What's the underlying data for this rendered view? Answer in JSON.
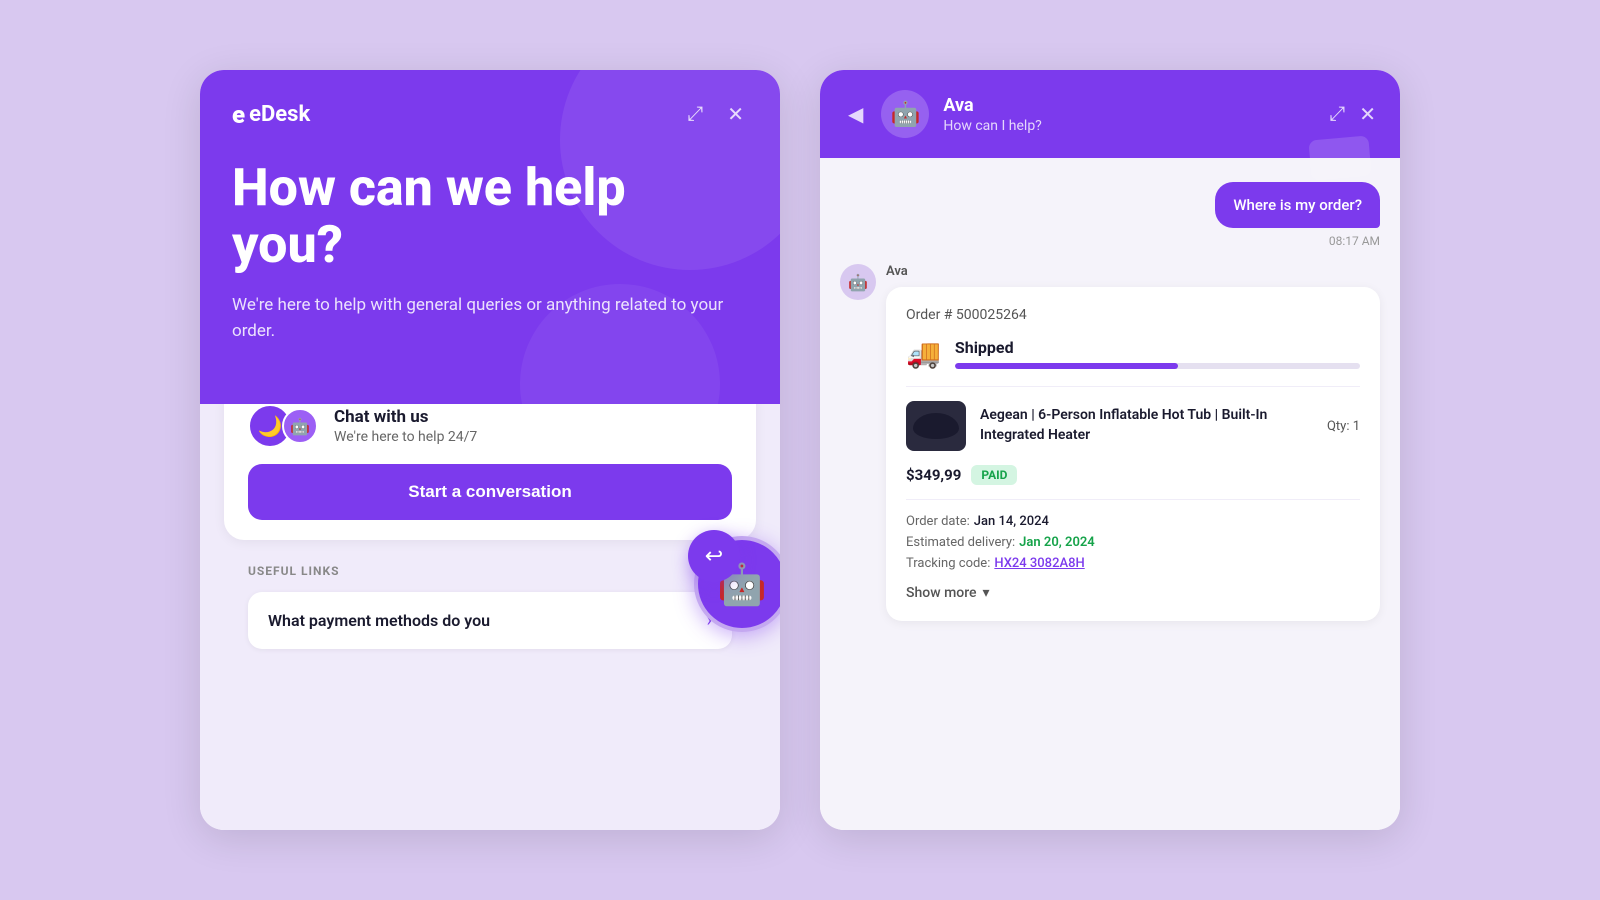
{
  "left": {
    "logo": "eDesk",
    "expand_icon": "⤢",
    "close_icon": "✕",
    "title": "How can we help you?",
    "subtitle": "We're here to help with general queries or anything related to your order.",
    "chat_option": {
      "title": "Chat with us",
      "description": "We're here to help 24/7"
    },
    "start_button": "Start a conversation",
    "useful_links_title": "USEFUL LINKS",
    "useful_links": [
      {
        "text": "What payment methods do you"
      }
    ]
  },
  "right": {
    "back_icon": "◀",
    "bot_name": "Ava",
    "bot_status": "How can I help?",
    "expand_icon": "⤢",
    "close_icon": "✕",
    "messages": [
      {
        "type": "user",
        "text": "Where is my order?",
        "time": "08:17 AM"
      },
      {
        "type": "bot",
        "sender": "Ava",
        "order": {
          "number": "Order # 500025264",
          "status": "Shipped",
          "progress": 55,
          "product_name": "Aegean | 6-Person Inflatable Hot Tub | Built-In Integrated Heater",
          "price": "$349,99",
          "paid_label": "PAID",
          "qty": "Qty: 1",
          "order_date_label": "Order date:",
          "order_date_value": "Jan 14, 2024",
          "delivery_label": "Estimated delivery:",
          "delivery_value": "Jan 20, 2024",
          "tracking_label": "Tracking code:",
          "tracking_value": "HX24 3082A8H",
          "show_more": "Show more"
        }
      }
    ]
  },
  "colors": {
    "purple": "#7c3aed",
    "light_purple": "#d8c8f0",
    "green": "#16a34a"
  }
}
